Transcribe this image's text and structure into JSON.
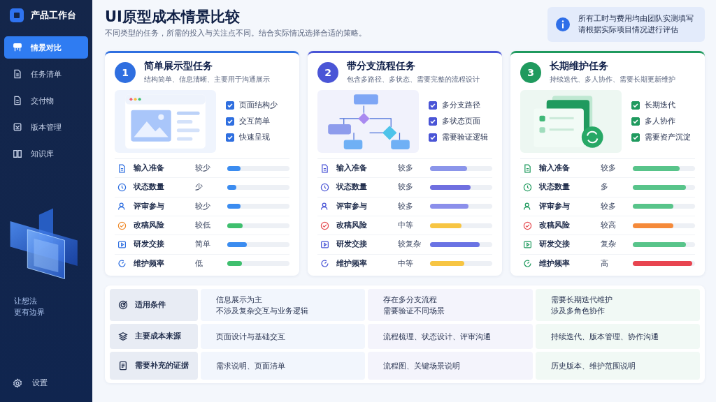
{
  "sidebar": {
    "brand": "产品工作台",
    "items": [
      {
        "label": "情景对比",
        "selected": true
      },
      {
        "label": "任务清单",
        "selected": false
      },
      {
        "label": "交付物",
        "selected": false
      },
      {
        "label": "版本管理",
        "selected": false
      },
      {
        "label": "知识库",
        "selected": false
      }
    ],
    "slogan": [
      "让想法",
      "更有边界"
    ],
    "settings": "设置"
  },
  "header": {
    "title": "UI原型成本情景比较",
    "subtitle": "不同类型的任务，所需的投入与关注点不同。结合实际情况选择合适的策略。",
    "notice": [
      "所有工时与费用均由团队实测填写",
      "请根据实际项目情况进行评估"
    ]
  },
  "cards": [
    {
      "number": "1",
      "title": "简单展示型任务",
      "subtitle": "结构简单、信息清晰、主要用于沟通展示",
      "color": "#2f6fe0",
      "kind": "browser",
      "checklist": [
        {
          "label": "页面结构少",
          "checked": true
        },
        {
          "label": "交互简单",
          "checked": true
        },
        {
          "label": "快速呈现",
          "checked": true
        }
      ],
      "metrics": [
        {
          "label": "输入准备",
          "value": "较少",
          "level": 0.21,
          "color": "#3b8cf0"
        },
        {
          "label": "状态数量",
          "value": "少",
          "level": 0.15,
          "color": "#3b8cf0"
        },
        {
          "label": "评审参与",
          "value": "较少",
          "level": 0.21,
          "color": "#3b8cf0"
        },
        {
          "label": "改稿风险",
          "value": "较低",
          "level": 0.25,
          "color": "#3fbf6e"
        },
        {
          "label": "研发交接",
          "value": "简单",
          "level": 0.31,
          "color": "#3b8cf0"
        },
        {
          "label": "维护频率",
          "value": "低",
          "level": 0.24,
          "color": "#3fbf6e"
        }
      ]
    },
    {
      "number": "2",
      "title": "带分支流程任务",
      "subtitle": "包含多路径、多状态、需要完整的流程设计",
      "color": "#4a55d6",
      "kind": "flow",
      "checklist": [
        {
          "label": "多分支路径",
          "checked": true
        },
        {
          "label": "多状态页面",
          "checked": true
        },
        {
          "label": "需要验证逻辑",
          "checked": true
        }
      ],
      "metrics": [
        {
          "label": "输入准备",
          "value": "较多",
          "level": 0.6,
          "color": "#8b95ea"
        },
        {
          "label": "状态数量",
          "value": "较多",
          "level": 0.65,
          "color": "#6f6fe0"
        },
        {
          "label": "评审参与",
          "value": "较多",
          "level": 0.62,
          "color": "#8b8feb"
        },
        {
          "label": "改稿风险",
          "value": "中等",
          "level": 0.5,
          "color": "#f7c543"
        },
        {
          "label": "研发交接",
          "value": "较复杂",
          "level": 0.8,
          "color": "#6a73e4"
        },
        {
          "label": "维护频率",
          "value": "中等",
          "level": 0.55,
          "color": "#f7c543"
        }
      ]
    },
    {
      "number": "3",
      "title": "长期维护任务",
      "subtitle": "持续迭代、多人协作、需要长期更新维护",
      "color": "#1f9a5e",
      "kind": "layers",
      "checklist": [
        {
          "label": "长期迭代",
          "checked": true
        },
        {
          "label": "多人协作",
          "checked": true
        },
        {
          "label": "需要资产沉淀",
          "checked": true
        }
      ],
      "metrics": [
        {
          "label": "输入准备",
          "value": "较多",
          "level": 0.75,
          "color": "#58c48a"
        },
        {
          "label": "状态数量",
          "value": "多",
          "level": 0.85,
          "color": "#58c48a"
        },
        {
          "label": "评审参与",
          "value": "较多",
          "level": 0.65,
          "color": "#58c48a"
        },
        {
          "label": "改稿风险",
          "value": "较高",
          "level": 0.65,
          "color": "#f58a3a"
        },
        {
          "label": "研发交接",
          "value": "复杂",
          "level": 0.85,
          "color": "#58c48a"
        },
        {
          "label": "维护频率",
          "value": "高",
          "level": 0.95,
          "color": "#e84550"
        }
      ]
    }
  ],
  "table": {
    "rows": [
      {
        "label": "适用条件",
        "cells": [
          [
            "信息展示为主",
            "不涉及复杂交互与业务逻辑"
          ],
          [
            "存在多分支流程",
            "需要验证不同场景"
          ],
          [
            "需要长期迭代维护",
            "涉及多角色协作"
          ]
        ]
      },
      {
        "label": "主要成本来源",
        "cells": [
          [
            "页面设计与基础交互"
          ],
          [
            "流程梳理、状态设计、评审沟通"
          ],
          [
            "持续迭代、版本管理、协作沟通"
          ]
        ]
      },
      {
        "label": "需要补充的证据",
        "cells": [
          [
            "需求说明、页面清单"
          ],
          [
            "流程图、关键场景说明"
          ],
          [
            "历史版本、维护范围说明"
          ]
        ]
      }
    ]
  }
}
